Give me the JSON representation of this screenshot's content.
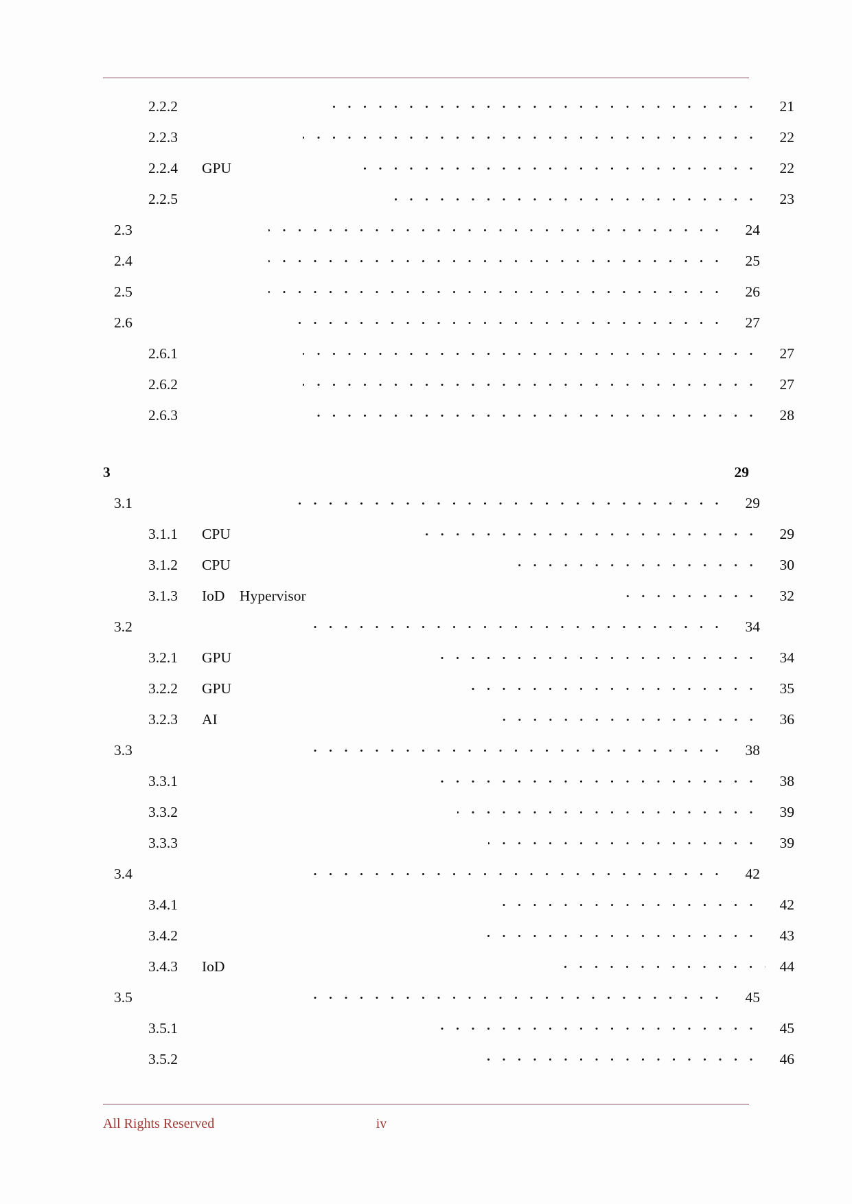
{
  "document": {
    "page_label": "iv",
    "footer_notice": "All Rights Reserved",
    "rule_color": "#8d4a63",
    "footer_color": "#9e3a33"
  },
  "toc": {
    "entries": [
      {
        "level": 3,
        "number": "2.2.2",
        "title": "",
        "page": "21",
        "bold": false,
        "leader": true
      },
      {
        "level": 3,
        "number": "2.2.3",
        "title": "",
        "page": "22",
        "bold": false,
        "leader": true
      },
      {
        "level": 3,
        "number": "2.2.4",
        "title": "GPU",
        "page": "22",
        "bold": false,
        "leader": true
      },
      {
        "level": 3,
        "number": "2.2.5",
        "title": "",
        "page": "23",
        "bold": false,
        "leader": true
      },
      {
        "level": 2,
        "number": "2.3",
        "title": "",
        "page": "24",
        "bold": false,
        "leader": true
      },
      {
        "level": 2,
        "number": "2.4",
        "title": "",
        "page": "25",
        "bold": false,
        "leader": true
      },
      {
        "level": 2,
        "number": "2.5",
        "title": "",
        "page": "26",
        "bold": false,
        "leader": true
      },
      {
        "level": 2,
        "number": "2.6",
        "title": "",
        "page": "27",
        "bold": false,
        "leader": true
      },
      {
        "level": 3,
        "number": "2.6.1",
        "title": "",
        "page": "27",
        "bold": false,
        "leader": true
      },
      {
        "level": 3,
        "number": "2.6.2",
        "title": "",
        "page": "27",
        "bold": false,
        "leader": true
      },
      {
        "level": 3,
        "number": "2.6.3",
        "title": "",
        "page": "28",
        "bold": false,
        "leader": true
      },
      {
        "level": 1,
        "number": "3",
        "title": "",
        "page": "29",
        "bold": true,
        "leader": false
      },
      {
        "level": 2,
        "number": "3.1",
        "title": "",
        "page": "29",
        "bold": false,
        "leader": true
      },
      {
        "level": 3,
        "number": "3.1.1",
        "title": "CPU",
        "page": "29",
        "bold": false,
        "leader": true
      },
      {
        "level": 3,
        "number": "3.1.2",
        "title": "CPU",
        "page": "30",
        "bold": false,
        "leader": true
      },
      {
        "level": 3,
        "number": "3.1.3",
        "title": "IoD    Hypervisor",
        "page": "32",
        "bold": false,
        "leader": true
      },
      {
        "level": 2,
        "number": "3.2",
        "title": "",
        "page": "34",
        "bold": false,
        "leader": true
      },
      {
        "level": 3,
        "number": "3.2.1",
        "title": "GPU",
        "page": "34",
        "bold": false,
        "leader": true
      },
      {
        "level": 3,
        "number": "3.2.2",
        "title": "GPU",
        "page": "35",
        "bold": false,
        "leader": true
      },
      {
        "level": 3,
        "number": "3.2.3",
        "title": "AI",
        "page": "36",
        "bold": false,
        "leader": true
      },
      {
        "level": 2,
        "number": "3.3",
        "title": "",
        "page": "38",
        "bold": false,
        "leader": true
      },
      {
        "level": 3,
        "number": "3.3.1",
        "title": "",
        "page": "38",
        "bold": false,
        "leader": true
      },
      {
        "level": 3,
        "number": "3.3.2",
        "title": "",
        "page": "39",
        "bold": false,
        "leader": true
      },
      {
        "level": 3,
        "number": "3.3.3",
        "title": "",
        "page": "39",
        "bold": false,
        "leader": true
      },
      {
        "level": 2,
        "number": "3.4",
        "title": "",
        "page": "42",
        "bold": false,
        "leader": true
      },
      {
        "level": 3,
        "number": "3.4.1",
        "title": "",
        "page": "42",
        "bold": false,
        "leader": true
      },
      {
        "level": 3,
        "number": "3.4.2",
        "title": "",
        "page": "43",
        "bold": false,
        "leader": true
      },
      {
        "level": 3,
        "number": "3.4.3",
        "title": "IoD",
        "page": "44",
        "bold": false,
        "leader": true
      },
      {
        "level": 2,
        "number": "3.5",
        "title": "",
        "page": "45",
        "bold": false,
        "leader": true
      },
      {
        "level": 3,
        "number": "3.5.1",
        "title": "",
        "page": "45",
        "bold": false,
        "leader": true
      },
      {
        "level": 3,
        "number": "3.5.2",
        "title": "",
        "page": "46",
        "bold": false,
        "leader": true
      }
    ],
    "leader_offsets": [
      250,
      225,
      265,
      345,
      225,
      225,
      225,
      265,
      225,
      225,
      240,
      0,
      265,
      345,
      490,
      530,
      275,
      380,
      425,
      490,
      290,
      420,
      450,
      495,
      290,
      510,
      480,
      560,
      285,
      410,
      490
    ],
    "gap_before": [
      0,
      0,
      0,
      0,
      0,
      0,
      0,
      0,
      0,
      0,
      0,
      38,
      0,
      0,
      0,
      0,
      0,
      0,
      0,
      0,
      0,
      0,
      0,
      0,
      0,
      0,
      0,
      0,
      0,
      0,
      0
    ]
  }
}
